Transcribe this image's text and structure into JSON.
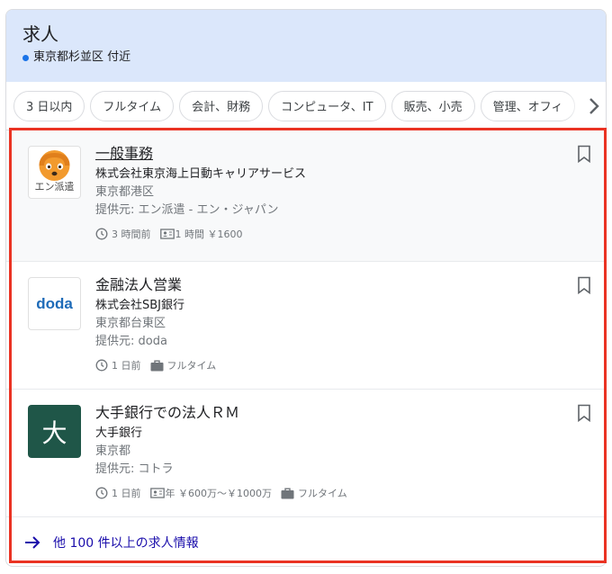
{
  "header": {
    "title": "求人",
    "location": "東京都杉並区 付近"
  },
  "chips": [
    "3 日以内",
    "フルタイム",
    "会計、財務",
    "コンピュータ、IT",
    "販売、小売",
    "管理、オフィ"
  ],
  "jobs": [
    {
      "title": "一般事務",
      "company": "株式会社東京海上日動キャリアサービス",
      "location": "東京都港区",
      "source": "提供元: エン派遣 - エン・ジャパン",
      "posted": "3 時間前",
      "pay": "1 時間 ￥1600",
      "type": "",
      "logo_text": "エン派遣"
    },
    {
      "title": "金融法人営業",
      "company": "株式会社SBJ銀行",
      "location": "東京都台東区",
      "source": "提供元: doda",
      "posted": "1 日前",
      "pay": "",
      "type": "フルタイム",
      "logo_text": "doda"
    },
    {
      "title": "大手銀行での法人ＲＭ",
      "company": "大手銀行",
      "location": "東京都",
      "source": "提供元: コトラ",
      "posted": "1 日前",
      "pay": "年 ￥600万〜￥1000万",
      "type": "フルタイム",
      "logo_text": "大"
    }
  ],
  "more_link": "他 100 件以上の求人情報",
  "colors": {
    "header_bg": "#dbe7fb",
    "accent": "#1a73e8",
    "highlight": "#ea3323",
    "link": "#1a0dab"
  }
}
